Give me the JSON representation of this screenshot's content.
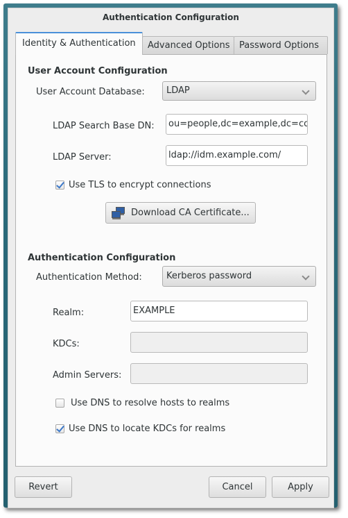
{
  "window": {
    "title": "Authentication Configuration"
  },
  "tabs": [
    {
      "label": "Identity & Authentication",
      "active": true
    },
    {
      "label": "Advanced Options",
      "active": false
    },
    {
      "label": "Password Options",
      "active": false
    }
  ],
  "user_account": {
    "heading": "User Account Configuration",
    "database_label": "User Account Database:",
    "database_value": "LDAP",
    "search_base_label": "LDAP Search Base DN:",
    "search_base_value": "ou=people,dc=example,dc=com",
    "server_label": "LDAP Server:",
    "server_value": "ldap://idm.example.com/",
    "tls_label": "Use TLS to encrypt connections",
    "tls_checked": true,
    "download_ca_label": "Download CA Certificate..."
  },
  "authentication": {
    "heading": "Authentication Configuration",
    "method_label": "Authentication Method:",
    "method_value": "Kerberos password",
    "realm_label": "Realm:",
    "realm_value": "EXAMPLE",
    "kdcs_label": "KDCs:",
    "kdcs_value": "",
    "admin_servers_label": "Admin Servers:",
    "admin_servers_value": "",
    "dns_hosts_label": "Use DNS to resolve hosts to realms",
    "dns_hosts_checked": false,
    "dns_kdcs_label": "Use DNS to locate KDCs for realms",
    "dns_kdcs_checked": true
  },
  "footer": {
    "revert_label": "Revert",
    "cancel_label": "Cancel",
    "apply_label": "Apply"
  },
  "icons": {
    "download_ca": "network-computers-icon",
    "combo": "chevron-down-icon",
    "checkbox_checked": "checkmark-icon"
  },
  "colors": {
    "frame_teal": "#2b6a7a",
    "tab_accent": "#4a90d9",
    "check_blue": "#3c78c8"
  }
}
